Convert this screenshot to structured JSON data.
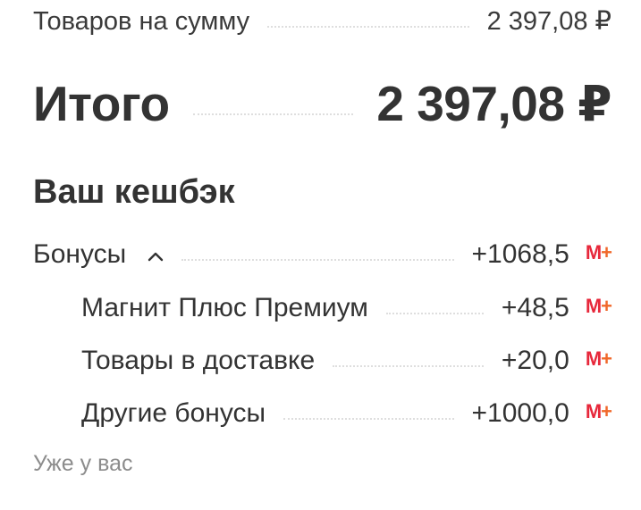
{
  "summary": {
    "subtotal_label": "Товаров на сумму",
    "subtotal_value": "2 397,08 ₽",
    "total_label": "Итого",
    "total_value": "2 397,08 ₽"
  },
  "cashback": {
    "title": "Ваш кешбэк",
    "bonuses": {
      "label": "Бонусы",
      "expanded": true,
      "value": "+1068,5",
      "badge": "М+"
    },
    "items": [
      {
        "label": "Магнит Плюс Премиум",
        "value": "+48,5",
        "badge": "М+"
      },
      {
        "label": "Товары в доставке",
        "value": "+20,0",
        "badge": "М+"
      },
      {
        "label": "Другие бонусы",
        "value": "+1000,0",
        "badge": "М+"
      }
    ],
    "already_label": "Уже у вас"
  },
  "colors": {
    "text": "#333333",
    "muted": "#8c8c8c",
    "badge_red": "#e7283b",
    "badge_orange": "#f0682a"
  }
}
